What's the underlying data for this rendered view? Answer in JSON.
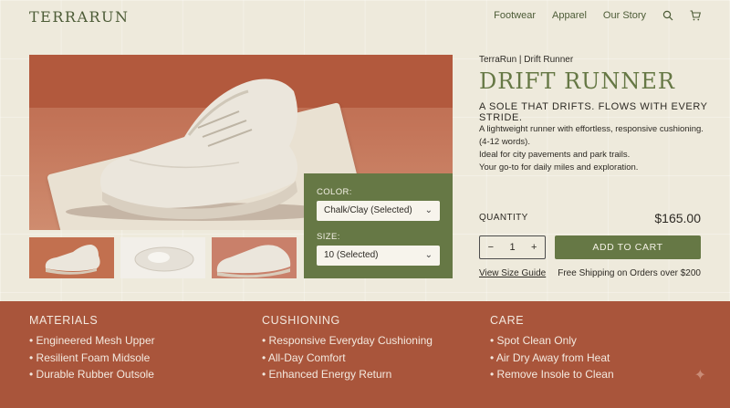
{
  "header": {
    "logo": "TERRARUN",
    "nav": [
      "Footwear",
      "Apparel",
      "Our Story"
    ],
    "icons": [
      "search-icon",
      "cart-icon"
    ]
  },
  "product": {
    "brand_line": "TerraRun | Drift Runner",
    "title": "DRIFT RUNNER",
    "tagline": "A SOLE THAT DRIFTS. FLOWS WITH EVERY STRIDE.",
    "description": [
      "A lightweight runner with effortless, responsive cushioning.",
      "(4-12 words).",
      "Ideal for city pavements and park trails.",
      "Your go-to for daily miles and exploration."
    ],
    "quantity_label": "QUANTITY",
    "quantity": "1",
    "minus": "−",
    "plus": "+",
    "price": "$165.00",
    "add_to_cart": "ADD TO CART",
    "size_guide": "View Size Guide",
    "shipping": "Free Shipping on Orders over $200"
  },
  "options": {
    "color_label": "COLOR:",
    "color_value": "Chalk/Clay (Selected)",
    "size_label": "SIZE:",
    "size_value": "10 (Selected)",
    "chevron": "⌄"
  },
  "features": [
    {
      "title": "MATERIALS",
      "items": [
        "Engineered Mesh Upper",
        "Resilient Foam Midsole",
        "Durable Rubber Outsole"
      ]
    },
    {
      "title": "CUSHIONING",
      "items": [
        "Responsive Everyday Cushioning",
        "All-Day Comfort",
        "Enhanced Energy Return"
      ]
    },
    {
      "title": "CARE",
      "items": [
        "Spot Clean Only",
        "Air Dry Away from Heat",
        "Remove Insole to Clean"
      ]
    }
  ],
  "colors": {
    "background": "#eeeadc",
    "accent_green": "#667845",
    "terracotta": "#a9553b"
  }
}
